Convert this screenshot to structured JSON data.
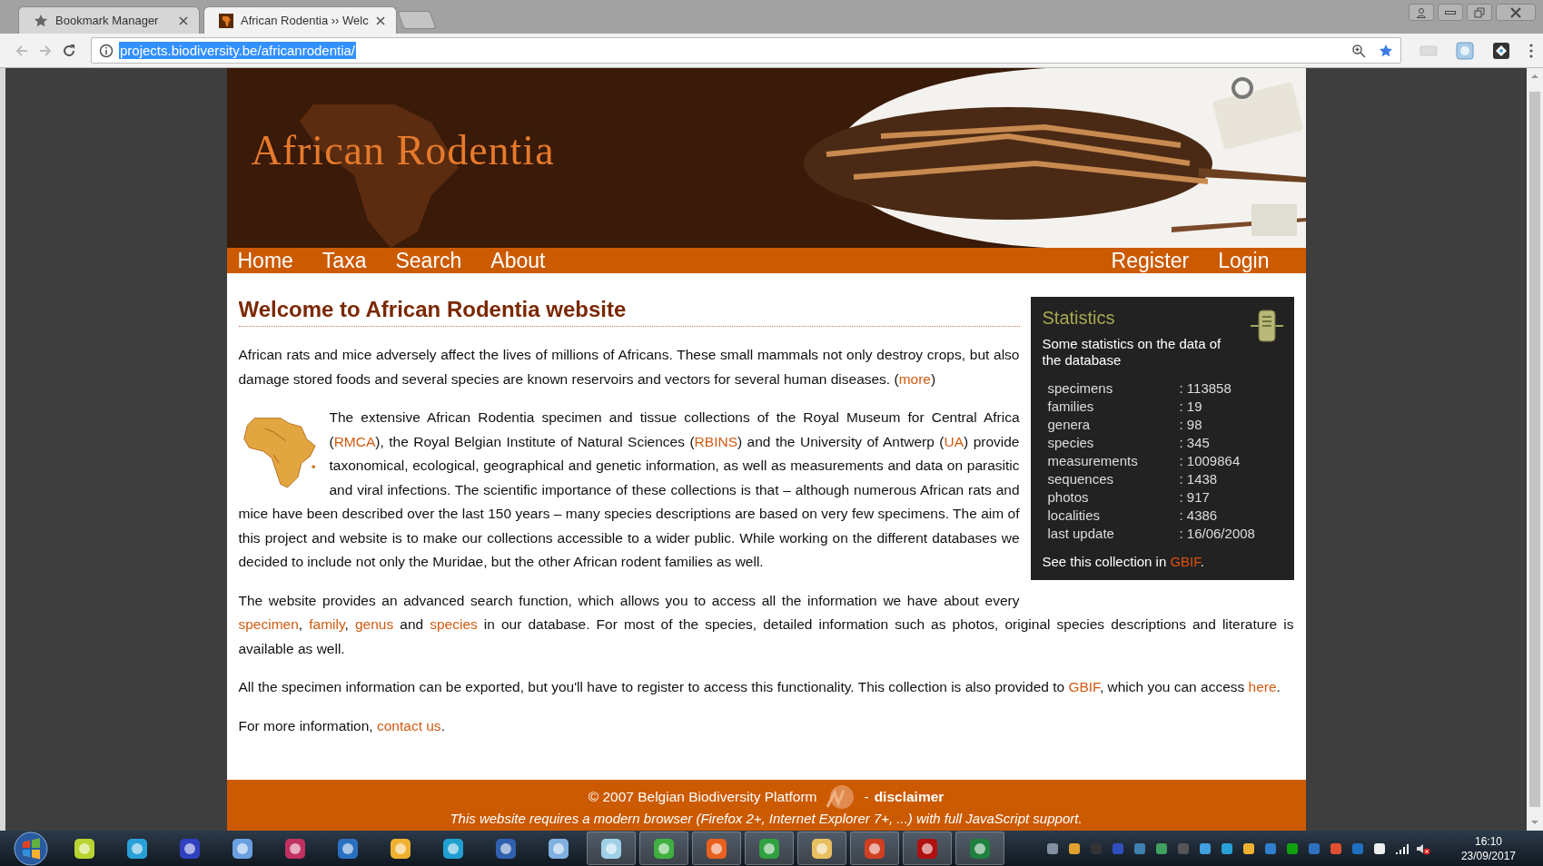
{
  "browser": {
    "tabs": [
      {
        "title": "Bookmark Manager",
        "selected": false
      },
      {
        "title": "African Rodentia ›› Welc",
        "selected": true
      }
    ],
    "address": {
      "value": "projects.biodiversity.be/africanrodentia/",
      "selected": true
    }
  },
  "site": {
    "title": "African Rodentia",
    "nav_left": [
      {
        "label": "Home"
      },
      {
        "label": "Taxa"
      },
      {
        "label": "Search"
      },
      {
        "label": "About"
      }
    ],
    "nav_right": [
      {
        "label": "Register"
      },
      {
        "label": "Login"
      }
    ]
  },
  "heading": "Welcome to African Rodentia website",
  "paragraphs": [
    {
      "kind": "narrow",
      "segments": [
        {
          "text": "African rats and mice adversely affect the lives of millions of Africans. These small mammals not only destroy crops, but also damage stored foods and several species are known reservoirs and vectors for several human diseases. ("
        },
        {
          "link": "more"
        },
        {
          "text": ")"
        }
      ]
    },
    {
      "kind": "with_map",
      "segments": [
        {
          "text": "The extensive African Rodentia specimen and tissue collections of the Royal Museum for Central Africa ("
        },
        {
          "link": "RMCA"
        },
        {
          "text": "), the Royal Belgian Institute of Natural Sciences ("
        },
        {
          "link": "RBINS"
        },
        {
          "text": ") and the University of Antwerp ("
        },
        {
          "link": "UA"
        },
        {
          "text": ") provide taxonomical, ecological, geographical and genetic information, as well as measurements and data on parasitic and viral infections. The scientific importance of these collections is that – although numerous African rats and mice have been described over the last 150 years – many species descriptions are based on very few specimens. The aim of this project and website is to make our collections accessible to a wider public. While working on the different databases we decided to include not only the Muridae, but the other African rodent families as well."
        }
      ]
    },
    {
      "kind": "narrow",
      "segments": [
        {
          "text": "The website provides an advanced search function, which allows you to access all the information we have about every "
        },
        {
          "link": "specimen"
        },
        {
          "text": ", "
        },
        {
          "link": "family"
        },
        {
          "text": ", "
        },
        {
          "link": "genus"
        },
        {
          "text": " and "
        },
        {
          "link": "species"
        },
        {
          "text": " in our database. For most of the species, detailed information such as photos, original species descriptions and literature is available as well."
        }
      ]
    },
    {
      "kind": "plain",
      "segments": [
        {
          "text": "All the specimen information can be exported, but you'll have to register to access this functionality. This collection is also provided to "
        },
        {
          "link": "GBIF"
        },
        {
          "text": ", which you can access "
        },
        {
          "link": "here"
        },
        {
          "text": "."
        }
      ]
    },
    {
      "kind": "plain",
      "segments": [
        {
          "text": "For more information, "
        },
        {
          "link": "contact us"
        },
        {
          "text": "."
        }
      ]
    }
  ],
  "statistics": {
    "title": "Statistics",
    "subtitle": "Some statistics on the data of the database",
    "rows": [
      {
        "label": "specimens",
        "value": ": 113858"
      },
      {
        "label": "families",
        "value": ": 19"
      },
      {
        "label": "genera",
        "value": ": 98"
      },
      {
        "label": "species",
        "value": ": 345"
      },
      {
        "label": "measurements",
        "value": ": 1009864"
      },
      {
        "label": "sequences",
        "value": ": 1438"
      },
      {
        "label": "photos",
        "value": ": 917"
      },
      {
        "label": "localities",
        "value": ": 4386"
      },
      {
        "label": "last update",
        "value": ": 16/06/2008"
      }
    ],
    "note": [
      {
        "text": "See this collection in "
      },
      {
        "link": "GBIF"
      },
      {
        "text": "."
      }
    ]
  },
  "footer": {
    "copyright": "© 2007 Belgian Biodiversity Platform",
    "separator": "-",
    "disclaimer": "disclaimer",
    "notice": "This website requires a modern browser (Firefox 2+, Internet Explorer 7+, ...) with full JavaScript support."
  },
  "taskbar": {
    "time": "16:10",
    "date": "23/09/2017"
  }
}
